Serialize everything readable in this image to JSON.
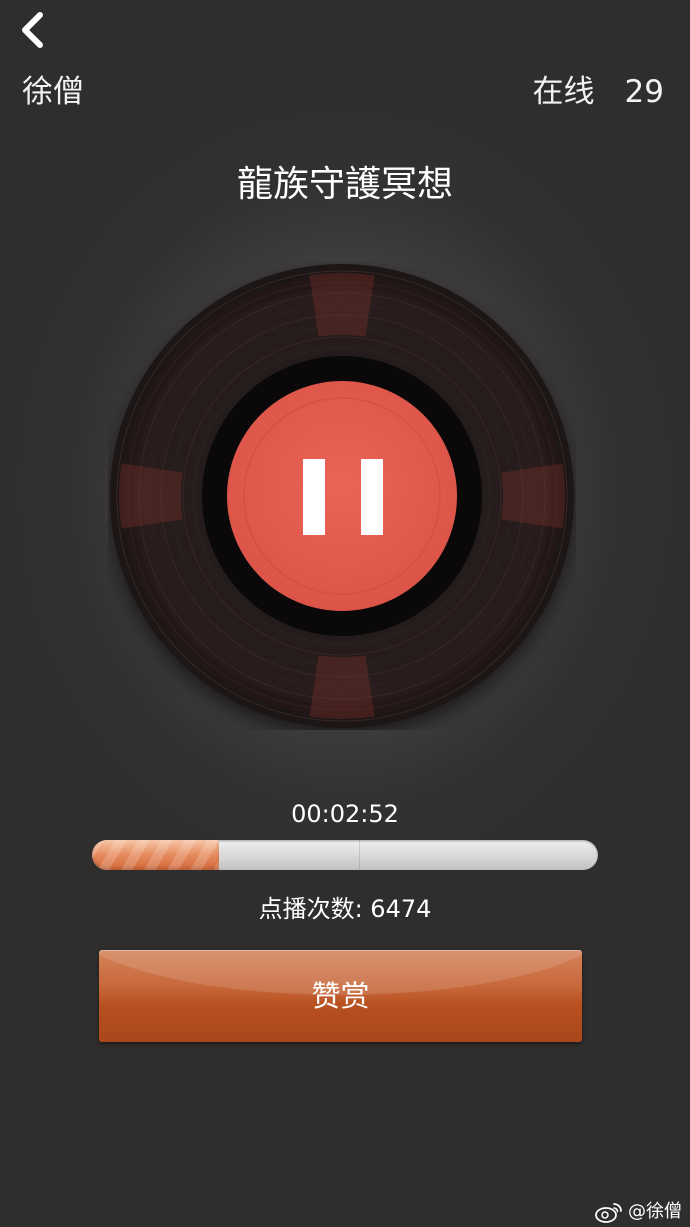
{
  "header": {
    "back_icon": "chevron-left-icon",
    "username": "徐僧",
    "online_label": "在线",
    "online_count": "29"
  },
  "player": {
    "title": "龍族守護冥想",
    "control_icon": "pause-icon",
    "state": "playing",
    "elapsed": "00:02:52",
    "progress_fraction": 0.25,
    "play_count_text": "点播次数: 6474"
  },
  "actions": {
    "reward_label": "赞赏"
  },
  "watermark": {
    "icon": "weibo-icon",
    "text": "@徐僧"
  },
  "colors": {
    "background": "#333130",
    "label_red": "#e45b4f",
    "progress_orange": "#e58a5c",
    "button_orange": "#b85020"
  }
}
